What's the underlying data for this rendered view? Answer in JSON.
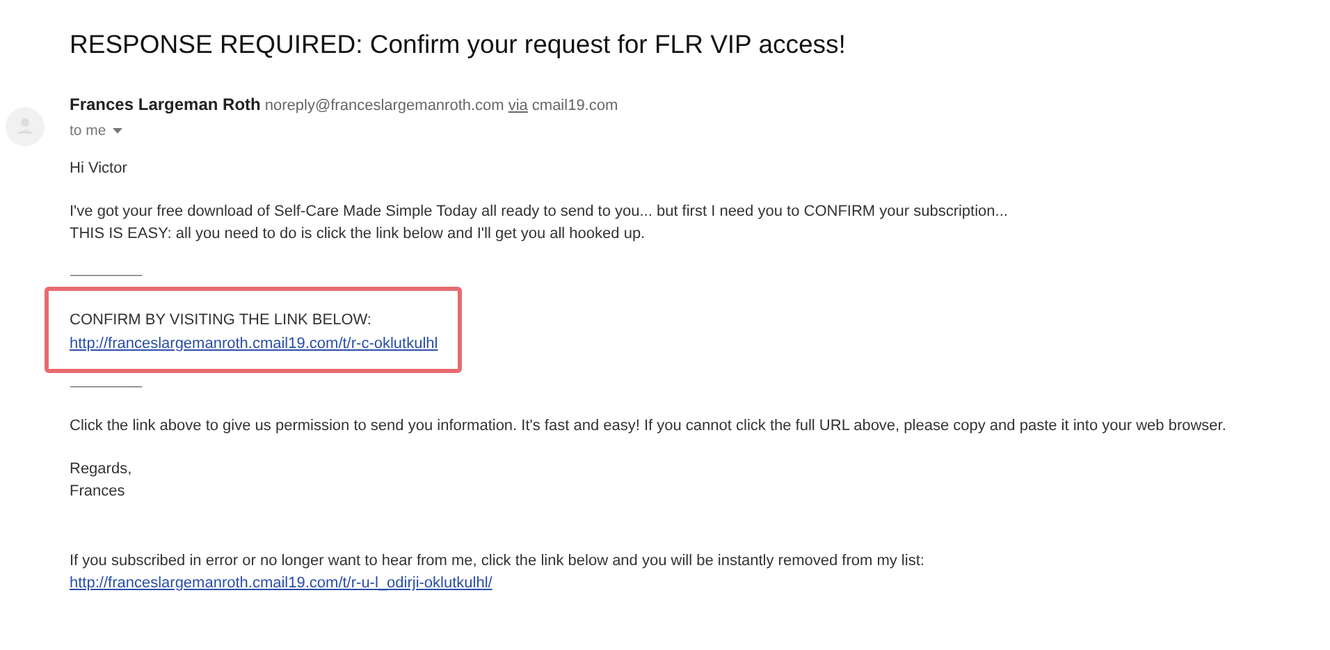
{
  "subject": "RESPONSE REQUIRED: Confirm your request for FLR VIP access!",
  "sender": {
    "name": "Frances Largeman Roth",
    "address": "noreply@franceslargemanroth.com",
    "via": "via",
    "domain": "cmail19.com",
    "recipient": "to me"
  },
  "body": {
    "greeting": "Hi Victor",
    "intro": [
      "I've got your free download of Self-Care Made Simple Today all ready to send to you... but first I need you to CONFIRM your subscription...",
      "THIS IS EASY: all you need to do is click the link below and I'll get you all hooked up."
    ],
    "divider_top": "-------------------------------",
    "confirm_box": {
      "label": "CONFIRM BY VISITING THE LINK BELOW:",
      "link": "http://franceslargemanroth.cmail19.com/t/r-c-oklutkulhl"
    },
    "divider_bottom": "-------------------------------",
    "permission": "Click the link above to give us permission to send you information. It's fast and easy! If you cannot click the full URL above, please copy and paste it into your web browser.",
    "signoff": [
      "Regards,",
      "Frances"
    ],
    "unsubscribe": "If you subscribed in error or no longer want to hear from me, click the link below and you will be instantly removed from my list:",
    "unsubscribe_link": "http://franceslargemanroth.cmail19.com/t/r-u-l_odirji-oklutkulhl/"
  }
}
